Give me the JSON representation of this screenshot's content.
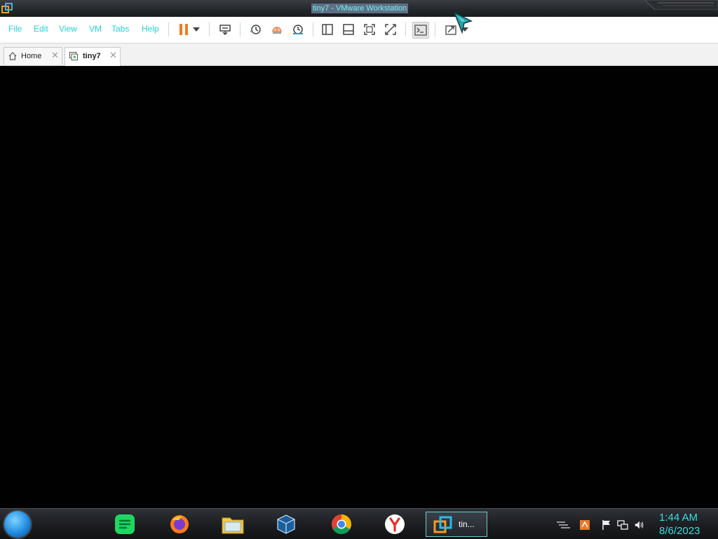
{
  "window": {
    "title": "tiny7 - VMware Workstation"
  },
  "menu": {
    "items": [
      "File",
      "Edit",
      "View",
      "VM",
      "Tabs",
      "Help"
    ]
  },
  "tabs": [
    {
      "label": "Home",
      "icon": "home-icon"
    },
    {
      "label": "tiny7",
      "icon": "vm-icon"
    }
  ],
  "taskbar": {
    "active_task": {
      "label": "tin...",
      "icon": "vmware-icon"
    },
    "pinned": [
      "notes-icon",
      "firefox-icon",
      "folder-icon",
      "virtualbox-icon",
      "chrome-icon",
      "yandex-icon"
    ],
    "tray": [
      "network-list-icon",
      "flag-icon",
      "network-icon",
      "volume-icon"
    ]
  },
  "clock": {
    "time": "1:44 AM",
    "date": "8/6/2023"
  },
  "colors": {
    "accent": "#34dfe0",
    "pause": "#f07a1f",
    "title_highlight": "#5f6e84"
  }
}
